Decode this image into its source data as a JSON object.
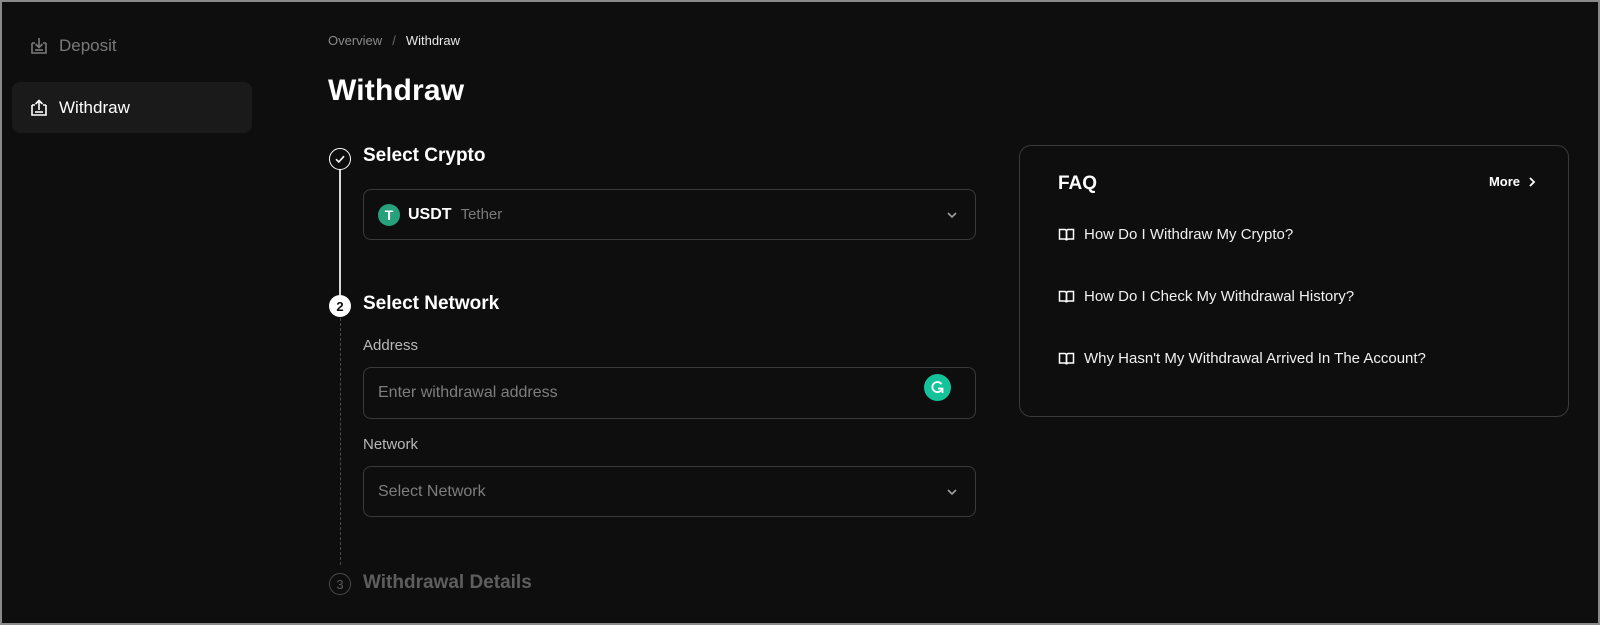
{
  "sidebar": {
    "items": [
      {
        "label": "Deposit",
        "icon": "deposit-icon",
        "active": false
      },
      {
        "label": "Withdraw",
        "icon": "withdraw-icon",
        "active": true
      }
    ]
  },
  "breadcrumb": {
    "parent": "Overview",
    "separator": "/",
    "current": "Withdraw"
  },
  "page_title": "Withdraw",
  "steps": [
    {
      "number": "",
      "title": "Select Crypto",
      "status": "done"
    },
    {
      "number": "2",
      "title": "Select Network",
      "status": "current"
    },
    {
      "number": "3",
      "title": "Withdrawal Details",
      "status": "pending"
    }
  ],
  "crypto_select": {
    "symbol": "USDT",
    "name": "Tether",
    "logo_letter": "T",
    "logo_color": "#26a17b"
  },
  "address_field": {
    "label": "Address",
    "placeholder": "Enter withdrawal address",
    "value": ""
  },
  "network_field": {
    "label": "Network",
    "placeholder": "Select Network"
  },
  "faq": {
    "title": "FAQ",
    "more_label": "More",
    "items": [
      {
        "label": "How Do I Withdraw My Crypto?"
      },
      {
        "label": "How Do I Check My Withdrawal History?"
      },
      {
        "label": "Why Hasn't My Withdrawal Arrived In The Account?"
      }
    ]
  },
  "colors": {
    "background": "#0e0e0e",
    "border": "#3a3a3a",
    "muted_text": "#7a7a7a",
    "tether_green": "#26a17b",
    "grammarly_green": "#15c39a"
  }
}
